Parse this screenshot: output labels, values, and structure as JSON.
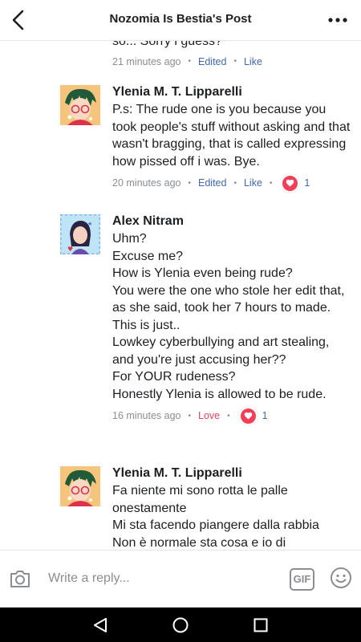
{
  "header": {
    "title": "Nozomia Is Bestia's Post"
  },
  "comments": [
    {
      "text": "so... Sorry i guess?",
      "time": "21 minutes ago",
      "edited": "Edited",
      "action": "Like"
    },
    {
      "author": "Ylenia M. T. Lipparelli",
      "text": "P.s: The rude one is you because you took people's stuff without asking and that wasn't bragging, that is called expressing how pissed off i was. Bye.",
      "time": "20 minutes ago",
      "edited": "Edited",
      "action": "Like",
      "reaction_count": "1"
    },
    {
      "author": "Alex Nitram",
      "text": "Uhm?\nExcuse me?\nHow is Ylenia even being rude?\nYou were the one who stole her edit that, as she said, took her 7 hours to made.\nThis is just..\nLowkey cyberbullying and art stealing, and you're just accusing her??\nFor YOUR rudeness?\nHonestly Ylenia is allowed to be rude.",
      "time": "16 minutes ago",
      "action": "Love",
      "reaction_count": "1"
    },
    {
      "author": "Ylenia M. T. Lipparelli",
      "text": "Fa niente mi sono rotta le palle onestamente\nMi sta facendo piangere dalla rabbia\nNon è normale sta cosa e io di"
    }
  ],
  "reply": {
    "placeholder": "Write a reply...",
    "gif_label": "GIF"
  },
  "icons": {
    "back": "back-arrow-icon",
    "more": "more-dots-icon",
    "camera": "camera-icon",
    "emoji": "smiley-icon",
    "heart": "heart-icon"
  },
  "colors": {
    "link": "#4267b2",
    "love": "#f33e58",
    "meta": "#8a8d91"
  }
}
